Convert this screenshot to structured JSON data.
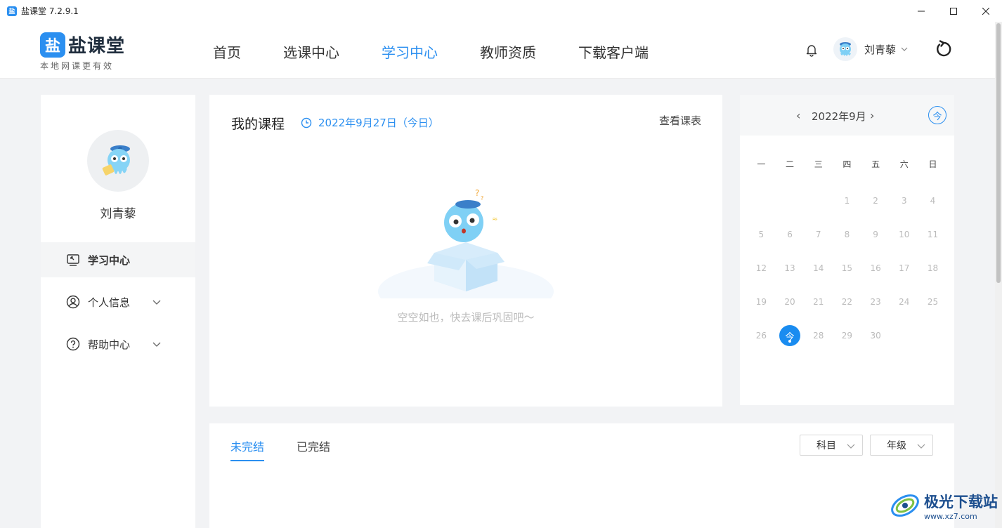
{
  "window": {
    "title": "盐课堂 7.2.9.1",
    "app_icon_glyph": "盐"
  },
  "header": {
    "logo_mark": "盐",
    "logo_name": "盐课堂",
    "logo_slogan": "本地网课更有效",
    "nav": [
      {
        "label": "首页"
      },
      {
        "label": "选课中心"
      },
      {
        "label": "学习中心",
        "active": true
      },
      {
        "label": "教师资质"
      },
      {
        "label": "下载客户端"
      }
    ],
    "user_name": "刘青藜"
  },
  "sidebar": {
    "profile_name": "刘青藜",
    "items": [
      {
        "label": "学习中心",
        "active": true
      },
      {
        "label": "个人信息"
      },
      {
        "label": "帮助中心"
      }
    ]
  },
  "course": {
    "title": "我的课程",
    "date": "2022年9月27日（今日）",
    "view_schedule": "查看课表",
    "empty_text": "空空如也，快去课后巩固吧～"
  },
  "calendar": {
    "prev": "‹",
    "month": "2022年9月",
    "next": "›",
    "today_button": "今",
    "weekdays": [
      "一",
      "二",
      "三",
      "四",
      "五",
      "六",
      "日"
    ],
    "days": [
      "",
      "",
      "",
      "1",
      "2",
      "3",
      "4",
      "5",
      "6",
      "7",
      "8",
      "9",
      "10",
      "11",
      "12",
      "13",
      "14",
      "15",
      "16",
      "17",
      "18",
      "19",
      "20",
      "21",
      "22",
      "23",
      "24",
      "25",
      "26",
      "今",
      "28",
      "29",
      "30",
      "",
      ""
    ],
    "today_marker": "今"
  },
  "bottom": {
    "tab_unfinished": "未完结",
    "tab_finished": "已完结",
    "filter_subject": "科目",
    "filter_grade": "年级"
  },
  "watermark": {
    "title": "极光下载站",
    "url": "www.xz7.com"
  },
  "colors": {
    "accent": "#2b8ff0",
    "background": "#f2f3f5"
  }
}
